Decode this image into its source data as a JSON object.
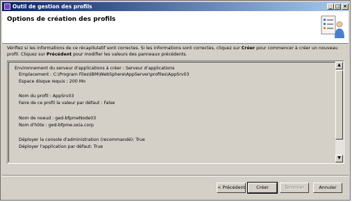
{
  "window": {
    "title": "Outil de gestion des profils",
    "controls": {
      "minimize": "_",
      "maximize": "□",
      "close": "×"
    }
  },
  "header": {
    "title": "Options de création des profils",
    "icon": "checklist-person-icon"
  },
  "description": {
    "part1": "Vérifiez si les informations de ce récapitulatif sont correctes. Si les informations sont correctes, cliquez sur ",
    "create_word": "Créer",
    "part2": " pour commencer à créer un nouveau profil. Cliquez sur ",
    "previous_word": "Précédent",
    "part3": " pour modifier les valeurs des panneaux précédents."
  },
  "summary": {
    "environment": "Environnement du serveur d'applications à créer : Serveur d'applications",
    "location": "Emplacement : C:\\Program Files\\IBM\\WebSphere\\AppServer\\profiles\\AppSrv03",
    "disk_space": "Espace disque requis : 200 Mo",
    "profile_name": "Nom du profil : AppSrv03",
    "default_profile": "Faire de ce profil la valeur par défaut : False",
    "node_name": "Nom de noeud : ged-bfpmeNode03",
    "host_name": "Nom d'hôte : ged-bfpme.oxia.corp",
    "deploy_console": "Déployer la console d'administration (recommandé): True",
    "deploy_default_app": "Déployer l'application par défaut: True"
  },
  "buttons": {
    "previous": "< Précédent",
    "create": "Créer",
    "finish": "Terminer",
    "cancel": "Annuler"
  }
}
